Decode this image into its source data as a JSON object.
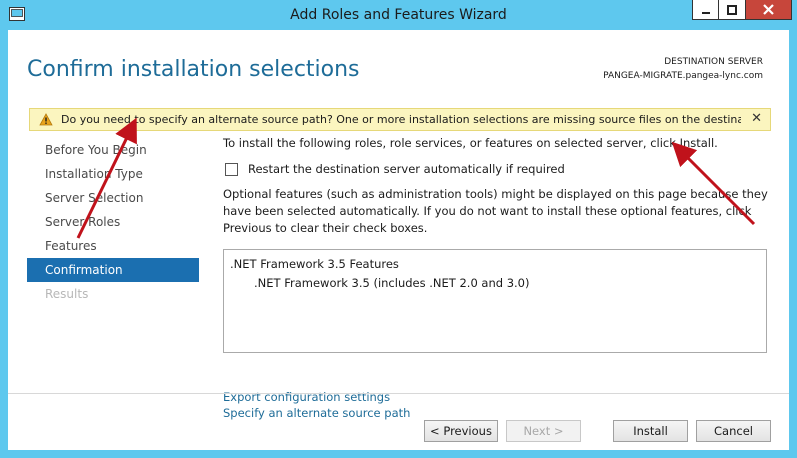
{
  "window": {
    "title": "Add Roles and Features Wizard",
    "controls": [
      "minimize-icon",
      "maximize-icon",
      "close-icon"
    ],
    "accent": "#5ec8ee",
    "close_color": "#c7463b"
  },
  "header": {
    "page_title": "Confirm installation selections",
    "dest_label": "DESTINATION SERVER",
    "dest_server": "PANGEA-MIGRATE.pangea-lync.com"
  },
  "warning": {
    "text": "Do you need to specify an alternate source path? One or more installation selections are missing source files on the destinati...",
    "icon": "warning-icon",
    "close": "✕"
  },
  "nav": {
    "items": [
      {
        "label": "Before You Begin",
        "state": "normal"
      },
      {
        "label": "Installation Type",
        "state": "normal"
      },
      {
        "label": "Server Selection",
        "state": "normal"
      },
      {
        "label": "Server Roles",
        "state": "normal"
      },
      {
        "label": "Features",
        "state": "normal"
      },
      {
        "label": "Confirmation",
        "state": "active"
      },
      {
        "label": "Results",
        "state": "disabled"
      }
    ],
    "active_color": "#1b6fb0"
  },
  "main": {
    "intro": "To install the following roles, role services, or features on selected server, click Install.",
    "restart_label": "Restart the destination server automatically if required",
    "restart_checked": false,
    "optional_text": "Optional features (such as administration tools) might be displayed on this page because they have been selected automatically. If you do not want to install these optional features, click Previous to clear their check boxes.",
    "selections": [
      ".NET Framework 3.5 Features",
      ".NET Framework 3.5 (includes .NET 2.0 and 3.0)"
    ],
    "export_link": "Export configuration settings",
    "alt_source_link": "Specify an alternate source path"
  },
  "buttons": {
    "previous": "< Previous",
    "next": "Next >",
    "install": "Install",
    "cancel": "Cancel"
  },
  "annotation_color": "#c0121b"
}
